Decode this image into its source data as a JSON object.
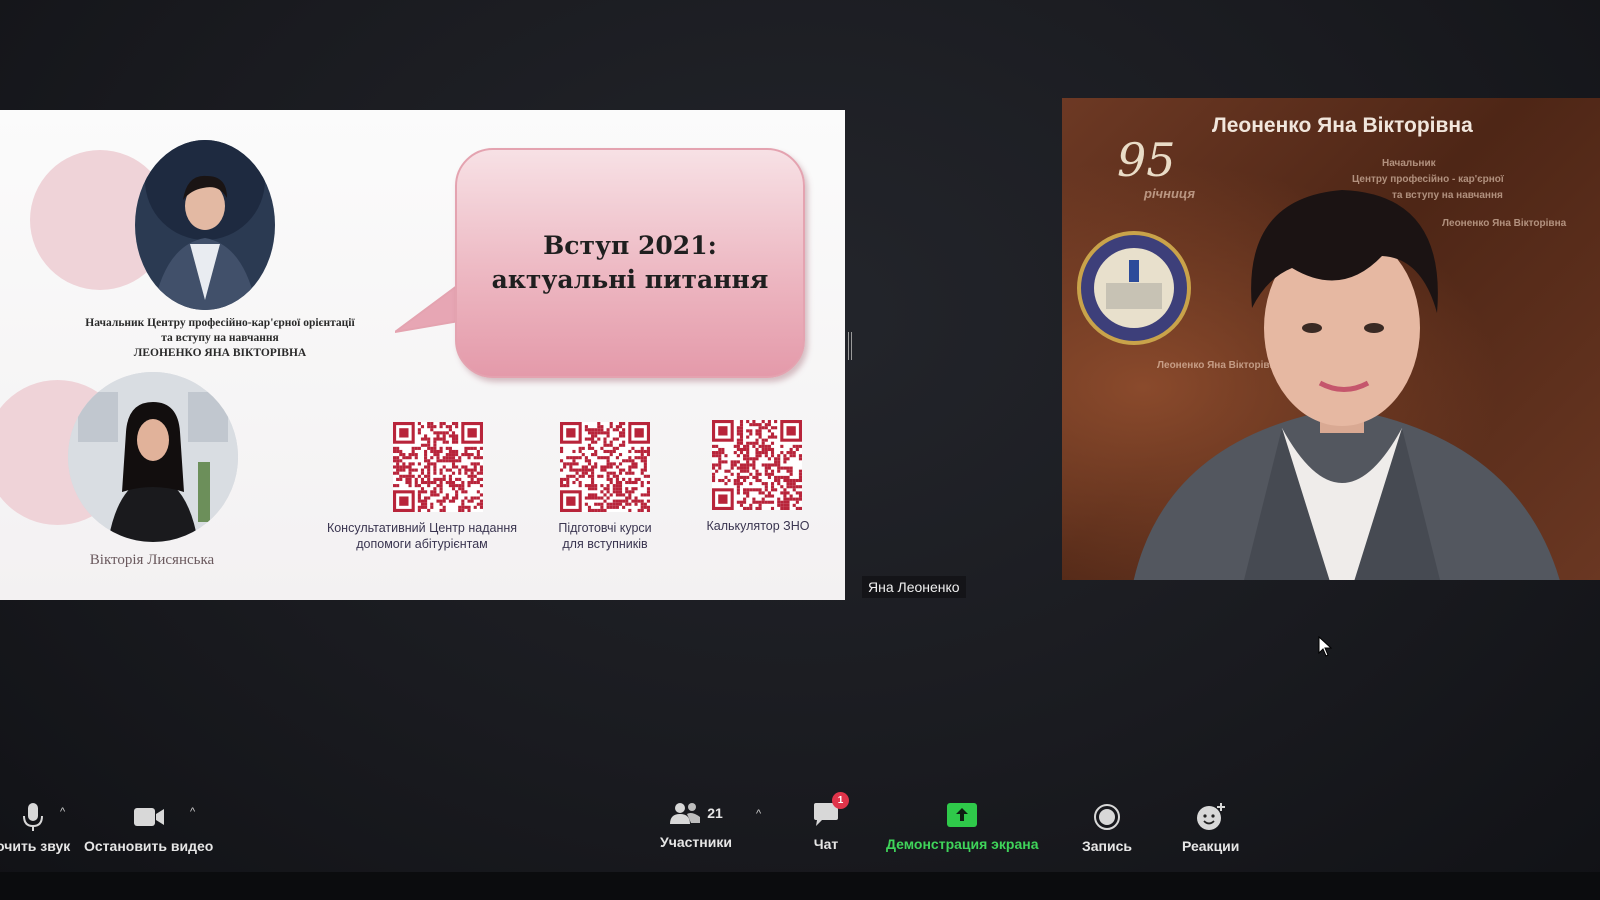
{
  "colors": {
    "toolbar_text": "#e6e6e6",
    "share_green": "#3fd45a",
    "badge_red": "#e0344a",
    "bubble_pink": "#ecb4bf",
    "qr_red": "#b8243a"
  },
  "slide": {
    "bubble_title_line1": "Вступ 2021:",
    "bubble_title_line2": "актуальні питання",
    "caption_line1": "Начальник Центру професійно-кар'єрної орієнтації",
    "caption_line2": "та вступу на навчання",
    "caption_line3": "ЛЕОНЕНКО ЯНА ВІКТОРІВНА",
    "second_person_name": "Вікторія Лисянська",
    "qr_codes": [
      {
        "label_line1": "Консультативний Центр надання",
        "label_line2": "допомоги абітурієнтам",
        "icon": "qr-code-icon"
      },
      {
        "label_line1": "Підготовчі курси",
        "label_line2": "для вступників",
        "icon": "qr-code-icon"
      },
      {
        "label_line1": "Калькулятор ЗНО",
        "label_line2": "",
        "icon": "qr-code-icon"
      }
    ]
  },
  "video": {
    "overlay_title": "Леоненко Яна Вікторівна",
    "overlay_sub1": "Начальник",
    "overlay_sub2": "Центру професійно - кар'єрної",
    "overlay_sub3": "та вступу на навчання",
    "anniversary_number": "95",
    "anniversary_word": "річниця",
    "participant_name": "Яна Леоненко"
  },
  "toolbar": {
    "audio": {
      "label": "очить звук",
      "icon": "microphone-icon"
    },
    "video": {
      "label": "Остановить видео",
      "icon": "video-camera-icon"
    },
    "participants": {
      "label": "Участники",
      "count": "21",
      "icon": "participants-icon"
    },
    "chat": {
      "label": "Чат",
      "badge": "1",
      "icon": "chat-icon"
    },
    "share": {
      "label": "Демонстрация экрана",
      "icon": "share-screen-icon"
    },
    "record": {
      "label": "Запись",
      "icon": "record-icon"
    },
    "reactions": {
      "label": "Реакции",
      "icon": "reaction-icon"
    }
  }
}
